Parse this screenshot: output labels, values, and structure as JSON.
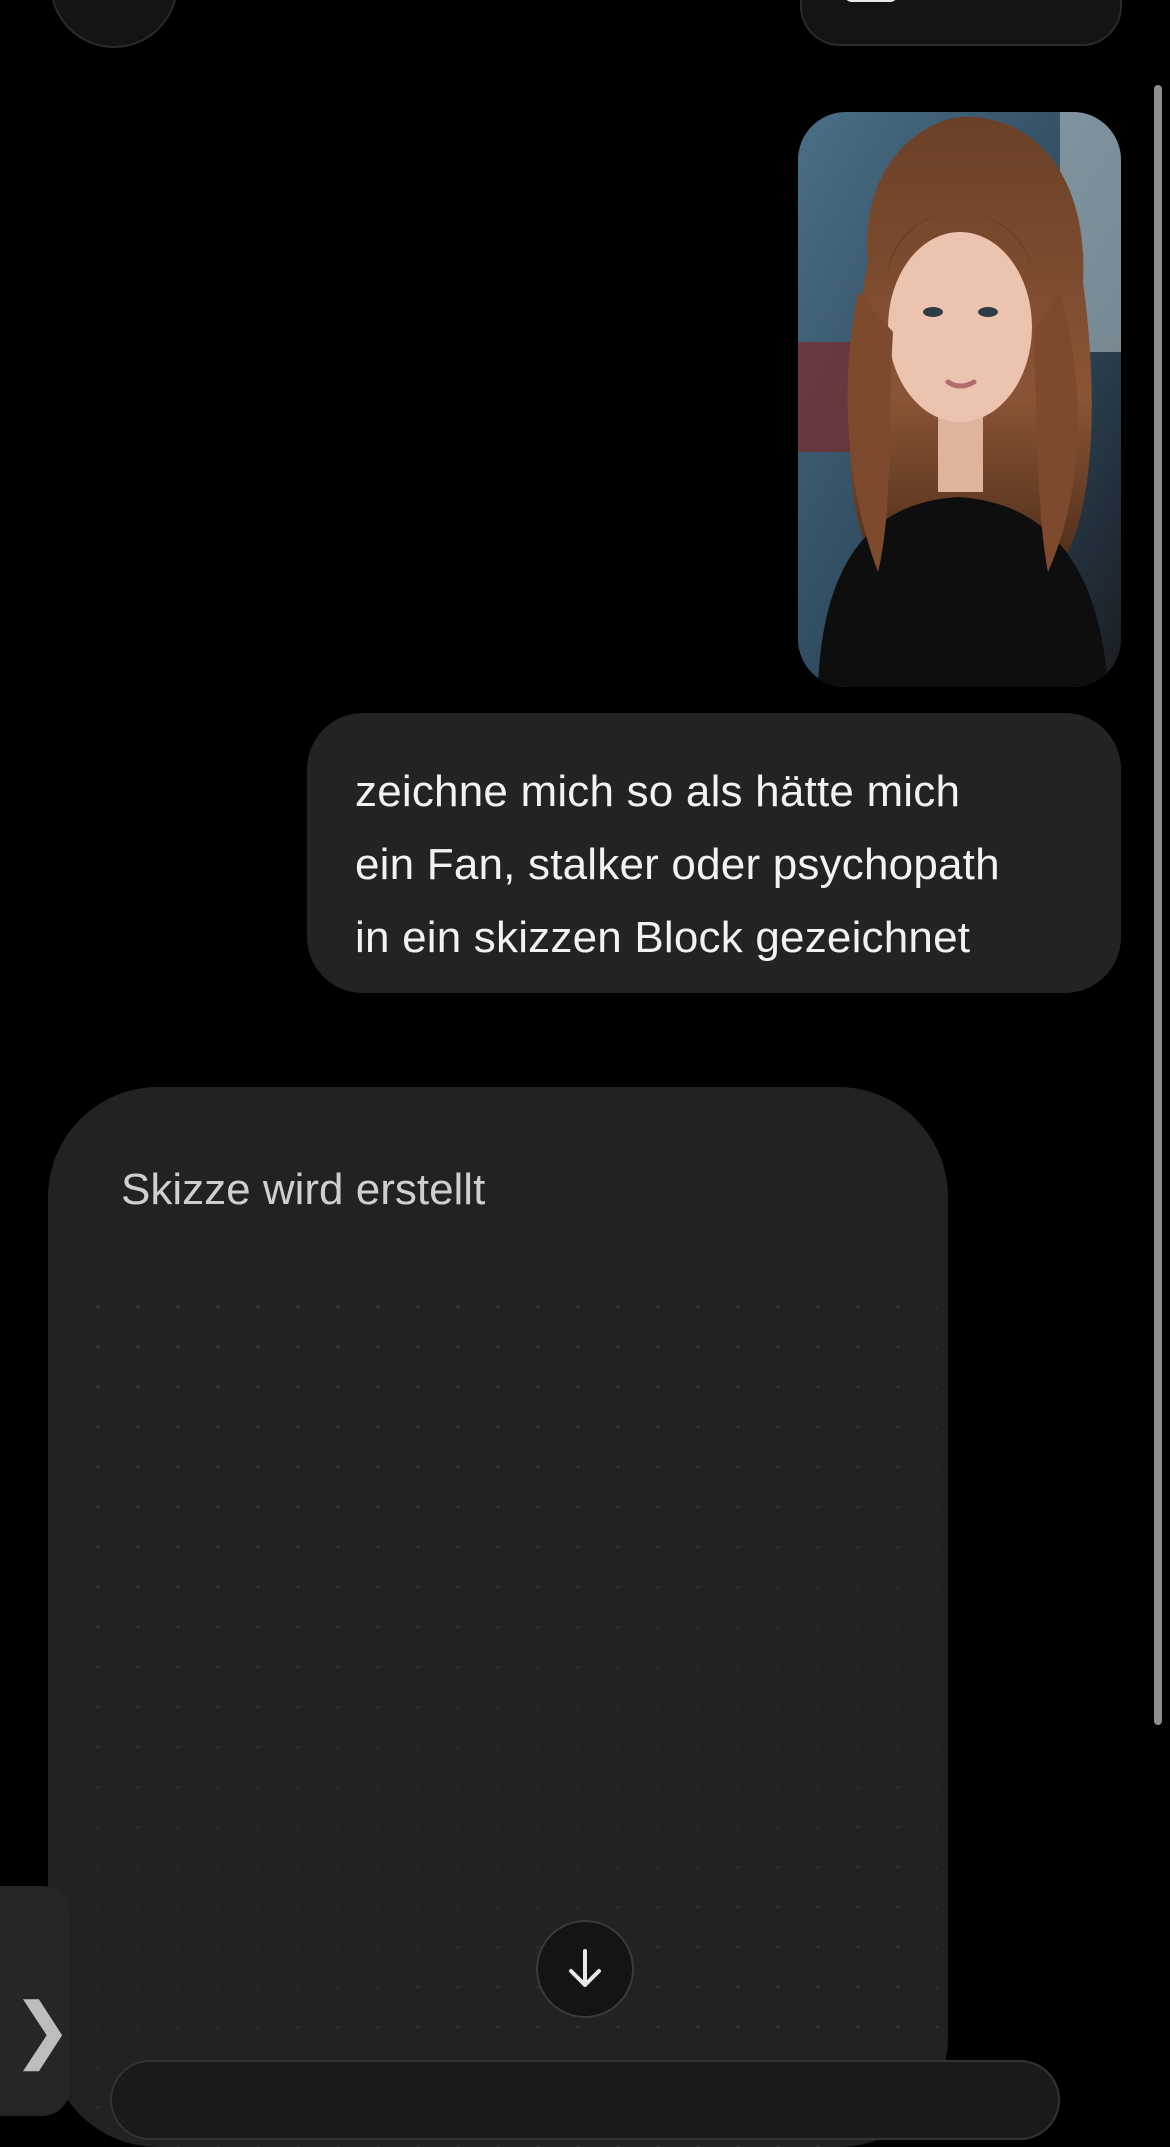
{
  "message": {
    "lines": [
      "zeichne mich so als hätte mich",
      "ein Fan, stalker oder psychopath",
      "in ein skizzen Block gezeichnet"
    ]
  },
  "sketch": {
    "title": "Skizze wird erstellt"
  },
  "side_tab": {
    "chevron": "❯"
  },
  "icons": {
    "scroll_down": "arrow-down-icon",
    "attachment": "user-photo-attachment"
  },
  "colors": {
    "background": "#000000",
    "bubble": "#232323",
    "card": "#222222"
  }
}
